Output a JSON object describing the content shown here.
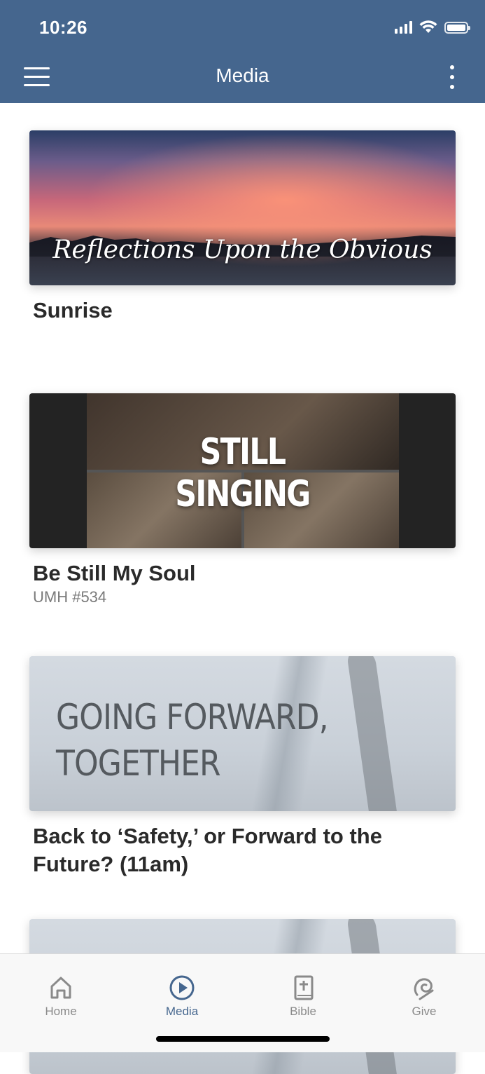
{
  "status_bar": {
    "time": "10:26"
  },
  "header": {
    "title": "Media",
    "accent": "#45668e"
  },
  "items": [
    {
      "title": "Sunrise",
      "subtitle": "",
      "thumbnail_text": "Reflections Upon the Obvious"
    },
    {
      "title": "Be Still My Soul",
      "subtitle": "UMH #534",
      "thumbnail_text_line1": "STILL",
      "thumbnail_text_line2": "SINGING"
    },
    {
      "title": "Back to ‘Safety,’ or Forward to the Future? (11am)",
      "subtitle": "",
      "thumbnail_text_line1": "GOING FORWARD,",
      "thumbnail_text_line2": "TOGETHER"
    }
  ],
  "tabbar": {
    "tabs": [
      {
        "label": "Home",
        "icon": "home-icon"
      },
      {
        "label": "Media",
        "icon": "play-circle-icon",
        "active": true
      },
      {
        "label": "Bible",
        "icon": "bible-icon"
      },
      {
        "label": "Give",
        "icon": "give-icon"
      }
    ]
  }
}
